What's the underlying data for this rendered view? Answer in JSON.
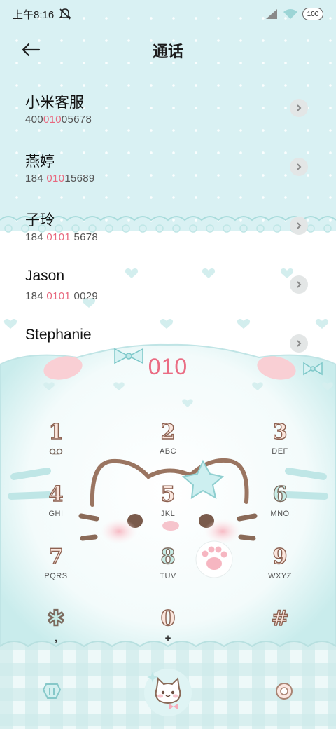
{
  "status_bar": {
    "time": "上午8:16",
    "battery": "100"
  },
  "header": {
    "title": "通话",
    "back_icon": "arrow-left-icon"
  },
  "contacts": [
    {
      "name": "小米客服",
      "number_parts": [
        "400",
        "010",
        "05678"
      ]
    },
    {
      "name": "燕婷",
      "number_parts": [
        "184 ",
        "010",
        "15689"
      ]
    },
    {
      "name": "子玲",
      "number_parts": [
        "184 ",
        "0101",
        " 5678"
      ]
    },
    {
      "name": "Jason",
      "number_parts": [
        "184 ",
        "0101",
        " 0029"
      ]
    },
    {
      "name": "Stephanie",
      "number_parts": [
        "",
        "",
        ""
      ]
    }
  ],
  "dialer": {
    "display": "010",
    "keys": [
      {
        "digit": "1",
        "letters": "",
        "icon": "voicemail-icon"
      },
      {
        "digit": "2",
        "letters": "ABC"
      },
      {
        "digit": "3",
        "letters": "DEF"
      },
      {
        "digit": "4",
        "letters": "GHI"
      },
      {
        "digit": "5",
        "letters": "JKL"
      },
      {
        "digit": "6",
        "letters": "MNO"
      },
      {
        "digit": "7",
        "letters": "PQRS"
      },
      {
        "digit": "8",
        "letters": "TUV"
      },
      {
        "digit": "9",
        "letters": "WXYZ"
      },
      {
        "digit": "✱",
        "letters": ",",
        "name": "star"
      },
      {
        "digit": "0",
        "letters": "+"
      },
      {
        "digit": "#",
        "letters": "",
        "name": "hash"
      }
    ]
  },
  "bottom_bar": {
    "left_icon": "collapse-keypad-icon",
    "center_icon": "call-cat-icon",
    "right_icon": "more-options-icon"
  },
  "colors": {
    "theme_mint": "#d9f1f3",
    "highlight_pink": "#e8697f",
    "digit_fill": "#fbe6dd",
    "digit_outline": "#8c6151"
  }
}
